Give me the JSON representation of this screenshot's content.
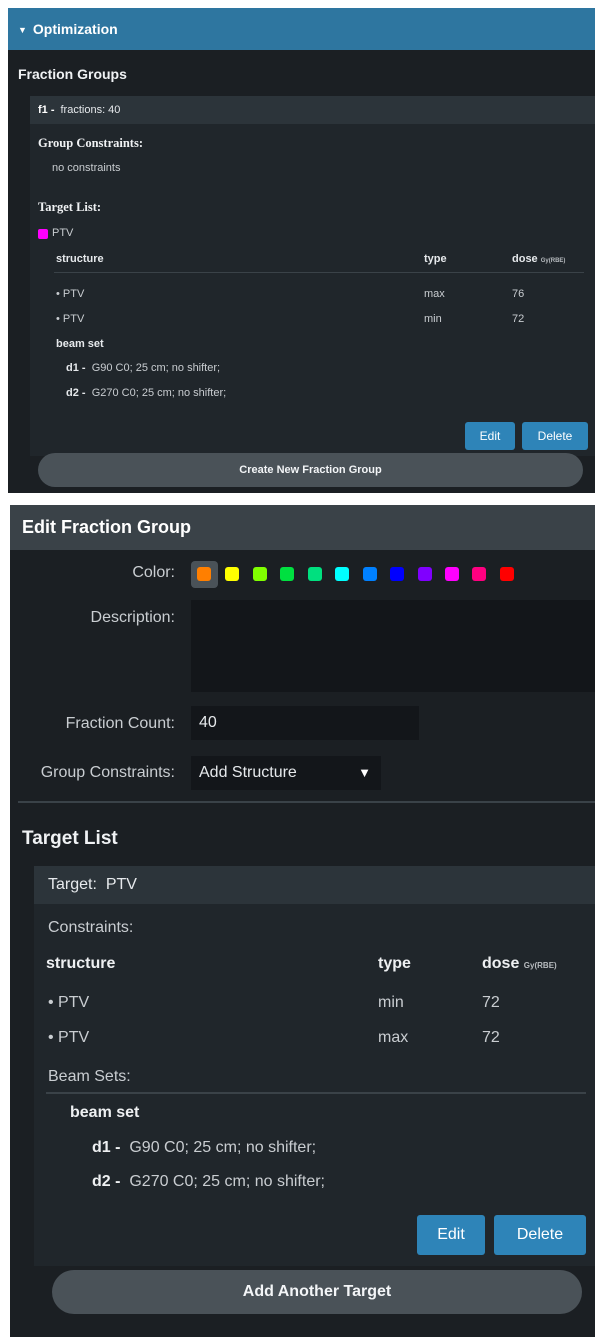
{
  "optimization": {
    "header": "Optimization",
    "fraction_groups_title": "Fraction Groups",
    "card": {
      "id": "f1 -",
      "fractions": "fractions: 40",
      "group_constraints_label": "Group Constraints:",
      "no_constraints": "no constraints",
      "target_list_label": "Target List:",
      "target_name": "PTV",
      "target_color": "#ff00ff",
      "columns": {
        "structure": "structure",
        "type": "type",
        "dose": "dose",
        "unit": "Gy(RBE)"
      },
      "rows": [
        {
          "structure": "• PTV",
          "type": "max",
          "dose": "76"
        },
        {
          "structure": "• PTV",
          "type": "min",
          "dose": "72"
        }
      ],
      "beam_set_label": "beam set",
      "beams": [
        {
          "id": "d1 -",
          "desc": "G90 C0; 25 cm; no shifter;"
        },
        {
          "id": "d2 -",
          "desc": "G270 C0; 25 cm; no shifter;"
        }
      ],
      "edit_label": "Edit",
      "delete_label": "Delete"
    },
    "create_button": "Create New Fraction Group"
  },
  "edit_fraction_group": {
    "header": "Edit Fraction Group",
    "color_label": "Color:",
    "colors": [
      "#ff7f00",
      "#ffff00",
      "#80ff00",
      "#00e040",
      "#00e07f",
      "#00ffff",
      "#0080ff",
      "#0000ff",
      "#8000ff",
      "#ff00ff",
      "#ff0080",
      "#ff0000"
    ],
    "selected_color": "#ff7f00",
    "description_label": "Description:",
    "description_value": "",
    "fraction_count_label": "Fraction Count:",
    "fraction_count_value": "40",
    "group_constraints_label": "Group Constraints:",
    "group_constraints_selected": "Add Structure",
    "target_list_title": "Target List",
    "target": {
      "label": "Target:",
      "name": "PTV",
      "constraints_label": "Constraints:",
      "columns": {
        "structure": "structure",
        "type": "type",
        "dose": "dose",
        "unit": "Gy(RBE)"
      },
      "rows": [
        {
          "structure": "• PTV",
          "type": "min",
          "dose": "72"
        },
        {
          "structure": "• PTV",
          "type": "max",
          "dose": "72"
        }
      ],
      "beam_sets_label": "Beam Sets:",
      "beam_set_label": "beam set",
      "beams": [
        {
          "id": "d1 -",
          "desc": "G90 C0; 25 cm; no shifter;"
        },
        {
          "id": "d2 -",
          "desc": "G270 C0; 25 cm; no shifter;"
        }
      ],
      "edit_label": "Edit",
      "delete_label": "Delete"
    },
    "add_target_button": "Add Another Target"
  }
}
